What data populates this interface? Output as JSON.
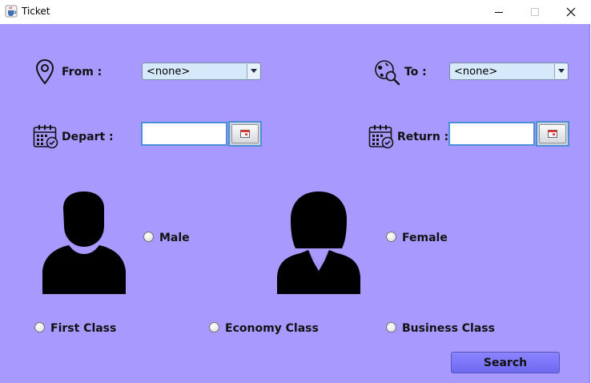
{
  "window": {
    "title": "Ticket",
    "icon": "java-cup-icon",
    "controls": [
      "minimize-icon",
      "maximize-icon",
      "close-icon"
    ]
  },
  "route": {
    "from_label": "From :",
    "from_value": "<none>",
    "to_label": "To :",
    "to_value": "<none>"
  },
  "dates": {
    "depart_label": "Depart :",
    "depart_value": "",
    "return_label": "Return :",
    "return_value": ""
  },
  "gender": {
    "male_label": "Male",
    "female_label": "Female"
  },
  "travel_class": {
    "first_label": "First Class",
    "economy_label": "Economy Class",
    "business_label": "Business Class"
  },
  "actions": {
    "search_label": "Search"
  },
  "colors": {
    "background": "#a899ff",
    "combo_background": "#d6e9fb",
    "search_button": "#7a74ff",
    "date_border": "#4a8fd8"
  }
}
